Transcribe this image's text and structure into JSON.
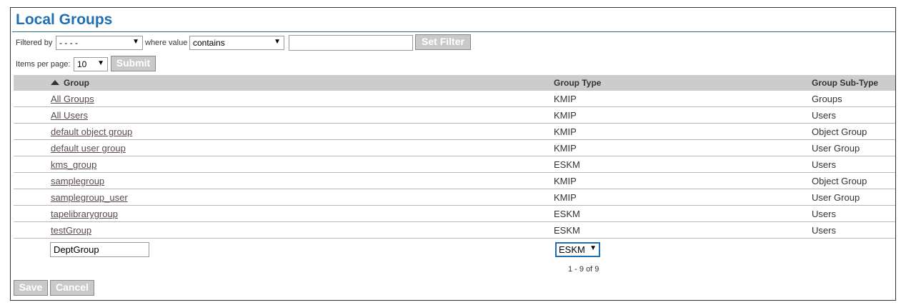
{
  "page": {
    "title": "Local Groups"
  },
  "filter": {
    "filtered_by_label": "Filtered by",
    "field_value": "- - - -",
    "where_value_label": "where value",
    "operator_value": "contains",
    "search_value": "",
    "set_filter_label": "Set Filter"
  },
  "paging": {
    "items_per_page_label": "Items per page:",
    "items_per_page_value": "10",
    "submit_label": "Submit",
    "summary": "1 - 9 of 9"
  },
  "table": {
    "columns": [
      "Group",
      "Group Type",
      "Group Sub-Type"
    ],
    "rows": [
      [
        "All Groups",
        "KMIP",
        "Groups"
      ],
      [
        "All Users",
        "KMIP",
        "Users"
      ],
      [
        "default object group",
        "KMIP",
        "Object Group"
      ],
      [
        "default user group",
        "KMIP",
        "User Group"
      ],
      [
        "kms_group",
        "ESKM",
        "Users"
      ],
      [
        "samplegroup",
        "KMIP",
        "Object Group"
      ],
      [
        "samplegroup_user",
        "KMIP",
        "User Group"
      ],
      [
        "tapelibrarygroup",
        "ESKM",
        "Users"
      ],
      [
        "testGroup",
        "ESKM",
        "Users"
      ]
    ]
  },
  "new_group": {
    "name_value": "DeptGroup",
    "type_value": "ESKM"
  },
  "actions": {
    "save_label": "Save",
    "cancel_label": "Cancel"
  }
}
